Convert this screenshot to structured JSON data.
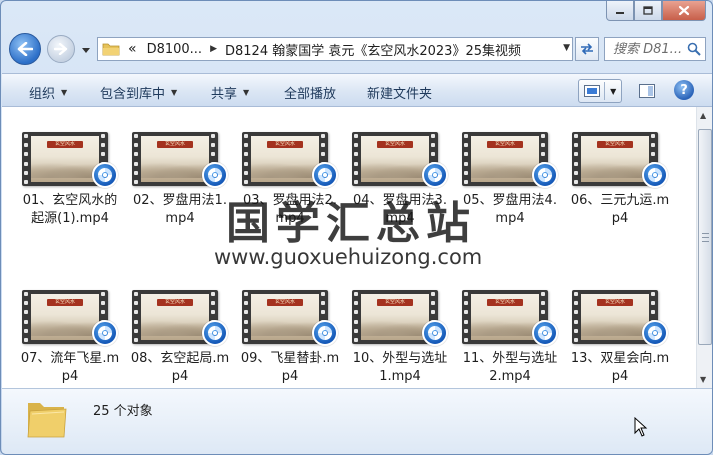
{
  "window": {
    "caption_buttons": [
      "minimize-icon",
      "maximize-icon",
      "close-icon"
    ]
  },
  "address_bar": {
    "overflow": "«",
    "segments": [
      "D8100...",
      "D8124 翰蒙国学 袁元《玄空风水2023》25集视频"
    ],
    "search_placeholder": "搜索 D81..."
  },
  "command_bar": {
    "organize": "组织",
    "include_in_library": "包含到库中",
    "share": "共享",
    "play_all": "全部播放",
    "new_folder": "新建文件夹"
  },
  "thumbnail_banner_text": "玄空风水",
  "files": [
    {
      "name": "01、玄空风水的起源(1).mp4"
    },
    {
      "name": "02、罗盘用法1.mp4"
    },
    {
      "name": "03、罗盘用法2.mp4"
    },
    {
      "name": "04、罗盘用法3.mp4"
    },
    {
      "name": "05、罗盘用法4.mp4"
    },
    {
      "name": "06、三元九运.mp4"
    },
    {
      "name": "07、流年飞星.mp4"
    },
    {
      "name": "08、玄空起局.mp4"
    },
    {
      "name": "09、飞星替卦.mp4"
    },
    {
      "name": "10、外型与选址1.mp4"
    },
    {
      "name": "11、外型与选址2.mp4"
    },
    {
      "name": "13、双星会向.mp4"
    }
  ],
  "watermark": {
    "title": "国学汇总站",
    "url": "www.guoxuehuizong.com"
  },
  "status": {
    "object_count": "25 个对象"
  },
  "colors": {
    "accent": "#2c6fc8",
    "toolbar_text": "#1e395b",
    "banner_red": "#a4321f"
  }
}
